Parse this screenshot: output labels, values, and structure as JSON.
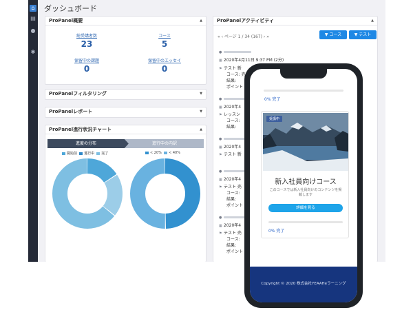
{
  "header": {
    "title": "ダッシュボード"
  },
  "sidebar": {
    "icons": [
      "home-icon",
      "book-icon",
      "user-icon",
      "gear-icon"
    ]
  },
  "overview": {
    "title": "ProPanel概要",
    "stats": [
      {
        "label": "総受講者数",
        "value": "23"
      },
      {
        "label": "コース",
        "value": "5"
      },
      {
        "label": "保留中の課題",
        "value": "0"
      },
      {
        "label": "保留中のエッセイ",
        "value": "0"
      }
    ]
  },
  "filter_panel": {
    "title": "ProPanelフィルタリング"
  },
  "report_panel": {
    "title": "ProPanelレポート"
  },
  "progress_panel": {
    "title": "ProPanel進行状況チャート",
    "tab1": "進度の分布",
    "tab2": "進行中の内訳",
    "legend1": [
      "開始前",
      "進行中",
      "完了"
    ],
    "legend2": [
      "< 20%",
      "< 40%"
    ]
  },
  "chart_data": [
    {
      "type": "pie",
      "title": "進度の分布",
      "categories": [
        "開始前",
        "進行中",
        "完了"
      ],
      "values": [
        16,
        20,
        64
      ],
      "colors": [
        "#4ea7d9",
        "#9ccde8",
        "#7ebfe2"
      ]
    },
    {
      "type": "pie",
      "title": "進行中の内訳",
      "categories": [
        "< 20%",
        "< 40%"
      ],
      "values": [
        50,
        50
      ],
      "colors": [
        "#3291cf",
        "#69b2e0"
      ]
    }
  ],
  "activity": {
    "title": "ProPanelアクティビティ",
    "pager": "« ‹ ページ 1 / 34 (167) › »",
    "btn_course": "コース",
    "btn_test": "テスト",
    "rows": {
      "date_full": "2020年4月11日 9:37 PM (2分)",
      "date_cut": "2020年4",
      "test": "テスト 新",
      "test_cut": "テスト 売",
      "course": "コース: 売",
      "course_cut": "コース: ",
      "lesson": "レッスン",
      "result": "結果: ",
      "point": "ポイント"
    }
  },
  "mobile": {
    "progress_top": "0% 完了",
    "badge": "受講中",
    "course_title": "新入社員向けコース",
    "course_desc": "このコースでは新入社員向けのコンテンツを掲載します",
    "detail_btn": "詳細を見る",
    "progress_bottom": "0% 完了",
    "copyright": "Copyright © 2020 株式会社YEAAHeラーニング"
  }
}
